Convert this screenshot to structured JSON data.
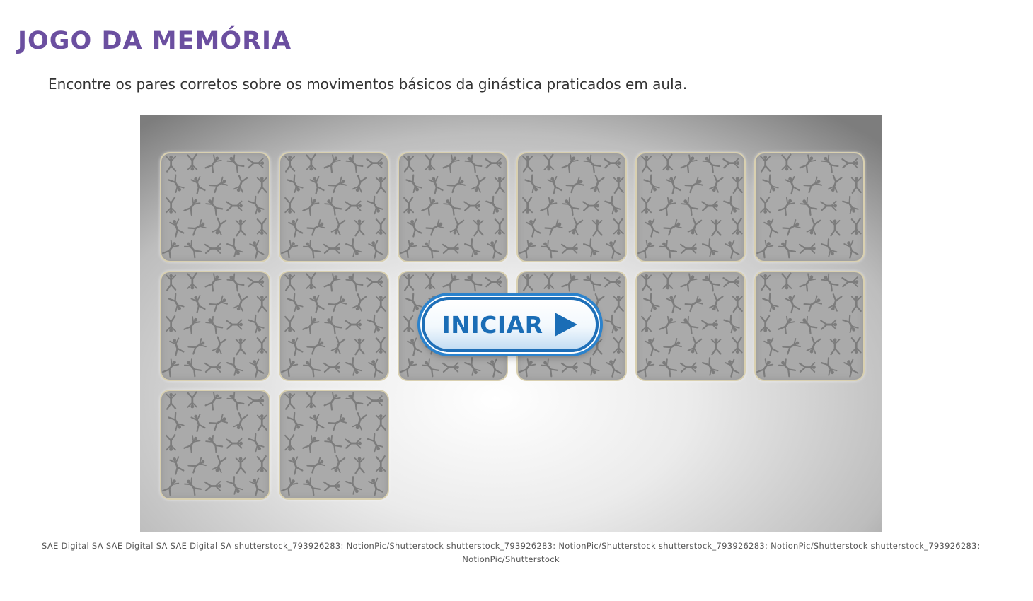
{
  "title": "JOGO DA MEMÓRIA",
  "instructions": "Encontre os pares corretos sobre os movimentos básicos da ginástica praticados em aula.",
  "game": {
    "card_count": 14,
    "start_button_label": "INICIAR",
    "start_icon": "play-icon",
    "card_back_icon": "gymnastics-silhouette-pattern"
  },
  "credits": "SAE Digital SA SAE Digital SA SAE Digital SA shutterstock_793926283: NotionPic/Shutterstock shutterstock_793926283: NotionPic/Shutterstock shutterstock_793926283: NotionPic/Shutterstock shutterstock_793926283: NotionPic/Shutterstock",
  "colors": {
    "title": "#6b4fa0",
    "button_text": "#1a6db6",
    "button_border": "#1e6fb8",
    "card_back": "#aaaaaa"
  }
}
